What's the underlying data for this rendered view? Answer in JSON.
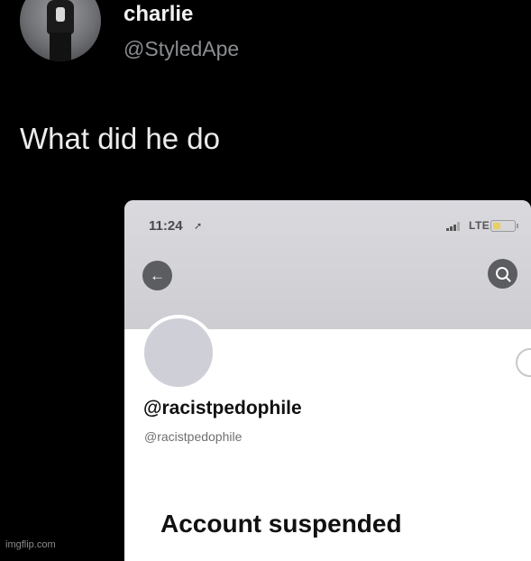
{
  "tweet": {
    "author_name": "charlie",
    "author_handle": "@StyledApe",
    "text": "What did he do"
  },
  "screenshot": {
    "status_bar": {
      "time": "11:24",
      "network": "LTE",
      "location_icon": "location-arrow-icon",
      "battery_level": 0.3
    },
    "nav": {
      "back_icon": "arrow-left-icon",
      "search_icon": "search-icon"
    },
    "profile": {
      "display_name": "@racistpedophile",
      "handle": "@racistpedophile",
      "status": "Account suspended"
    }
  },
  "watermark": "imgflip.com",
  "colors": {
    "background": "#000000",
    "banner": "#d2d2d7",
    "button": "#5b5d61",
    "handle_gray": "#8a8d91"
  }
}
